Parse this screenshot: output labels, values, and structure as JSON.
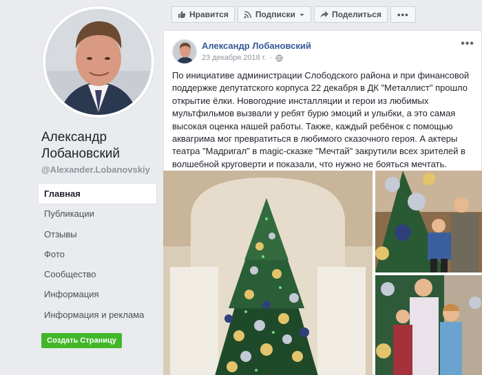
{
  "profile": {
    "name": "Александр Лобановский",
    "handle": "@Alexander.Lobanovskiy"
  },
  "nav": {
    "items": [
      "Главная",
      "Публикации",
      "Отзывы",
      "Фото",
      "Сообщество",
      "Информация",
      "Информация и реклама"
    ]
  },
  "create_page_label": "Создать Страницу",
  "actions": {
    "like": "Нравится",
    "subscribe": "Подписки",
    "share": "Поделиться"
  },
  "post": {
    "author": "Александр Лобановский",
    "date": "23 декабря 2018 г.",
    "text": "По инициативе администрации Слободского района и при финансовой поддержке депутатского корпуса 22 декабря в ДК \"Металлист\" прошло открытие ёлки. Новогодние инсталляции и герои из любимых мультфильмов вызвали у ребят бурю эмоций и улыбки, а это самая высокая оценка нашей работы. Также, каждый ребёнок с помощью аквагрима мог превратиться в любимого сказочного героя. А актеры театра \"Мадригал\" в magic-сказке \"Мечтай\" закрутили всех зрителей в волшебной круговерти и показали, что нужно не бояться мечтать."
  },
  "colors": {
    "link": "#365899",
    "create_button": "#42b72a",
    "background": "#e9ebee"
  }
}
